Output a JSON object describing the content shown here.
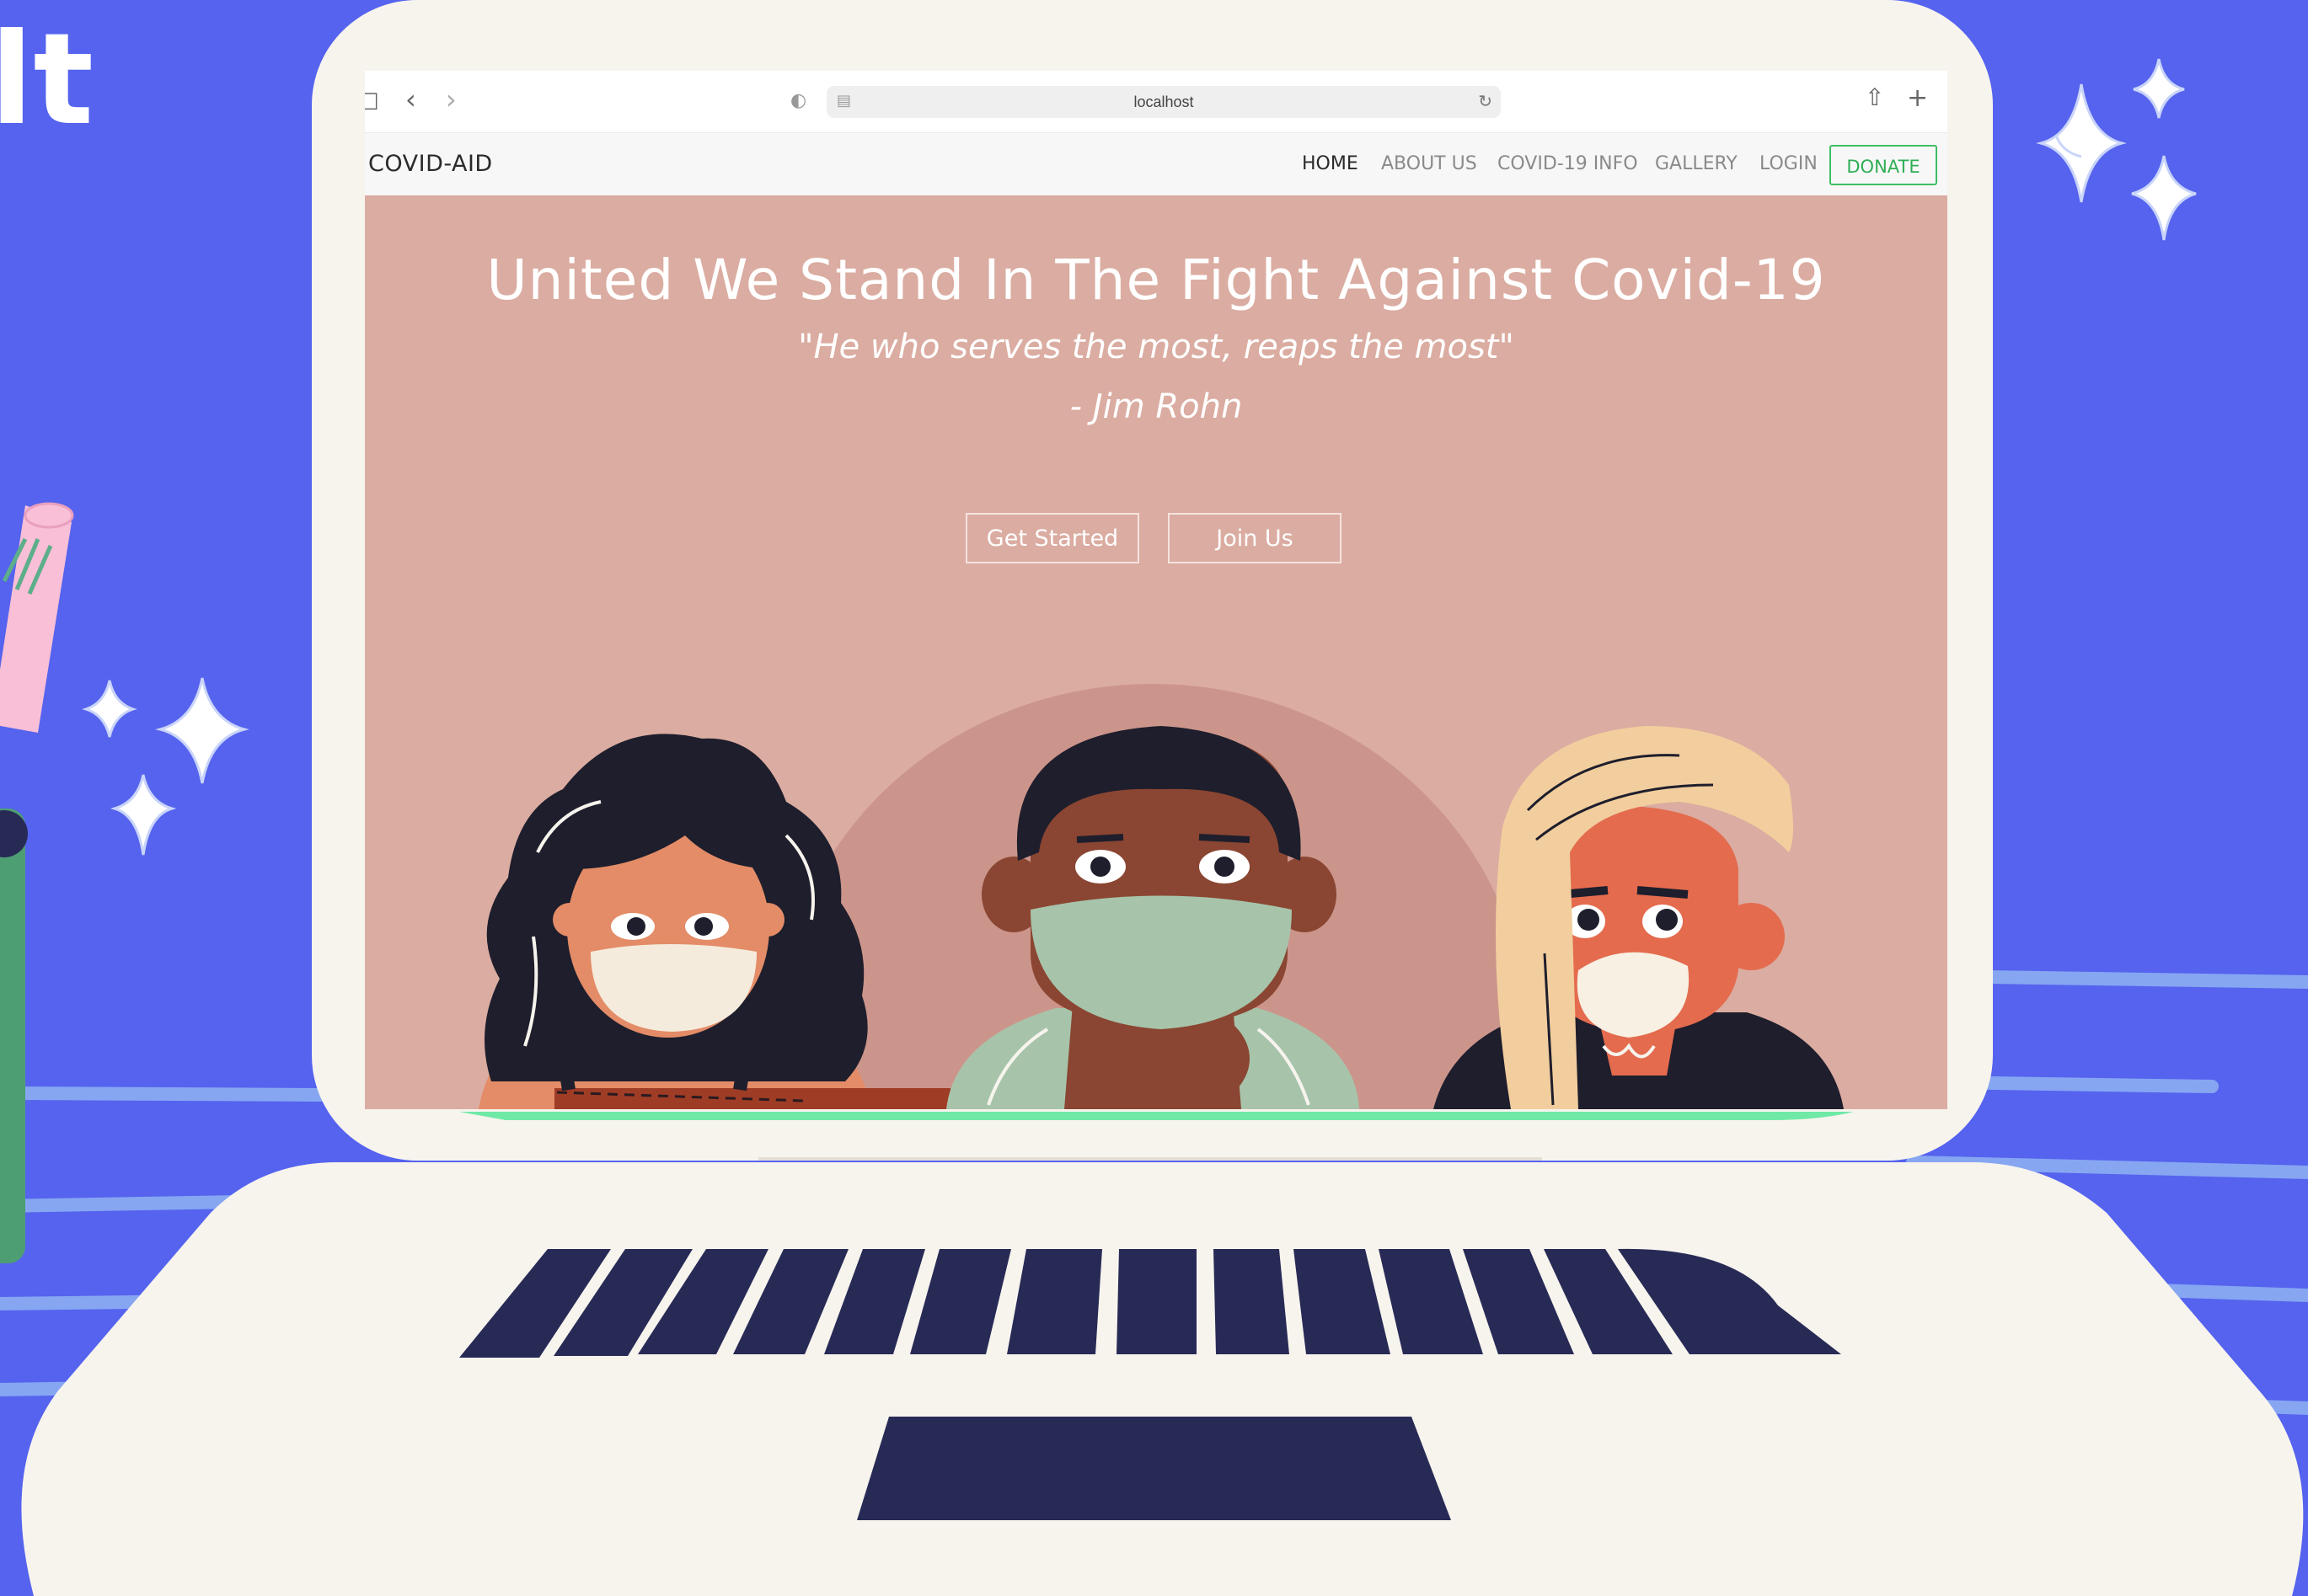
{
  "browser": {
    "url": "localhost"
  },
  "navbar": {
    "brand": "COVID-AID",
    "links": [
      "HOME",
      "ABOUT US",
      "COVID-19 INFO",
      "GALLERY",
      "LOGIN"
    ],
    "donate_label": "DONATE"
  },
  "hero": {
    "title": "United We Stand In The Fight Against Covid-19",
    "quote": "\"He who serves the most, reaps the most\"",
    "author": "- Jim Rohn",
    "buttons": [
      "Get Started",
      "Join Us"
    ]
  },
  "decor": {
    "logo_fragment": "lt"
  },
  "colors": {
    "background": "#5563EE",
    "laptop": "#F7F4EE",
    "hero": "#DBACA1",
    "keys": "#282A56",
    "donate": "#3DBE63"
  }
}
